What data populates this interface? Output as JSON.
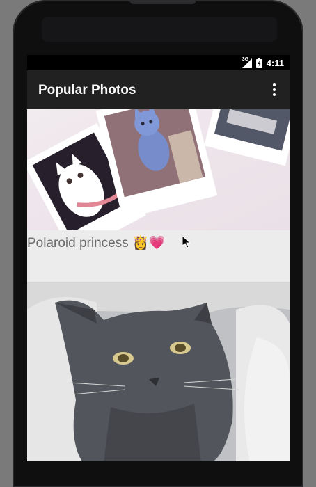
{
  "status_bar": {
    "network": "3G",
    "time": "4:11"
  },
  "app_bar": {
    "title": "Popular Photos",
    "overflow_icon": "overflow-menu-icon"
  },
  "feed": {
    "items": [
      {
        "caption": "Polaroid princess 👸💗",
        "image": "polaroid-photos-with-white-cat"
      },
      {
        "caption": "",
        "image": "grey-cat-portrait"
      }
    ]
  },
  "colors": {
    "app_bar": "#212121",
    "status_bar": "#000000",
    "caption_background": "#ececec",
    "caption_text": "#6d6d6d"
  }
}
